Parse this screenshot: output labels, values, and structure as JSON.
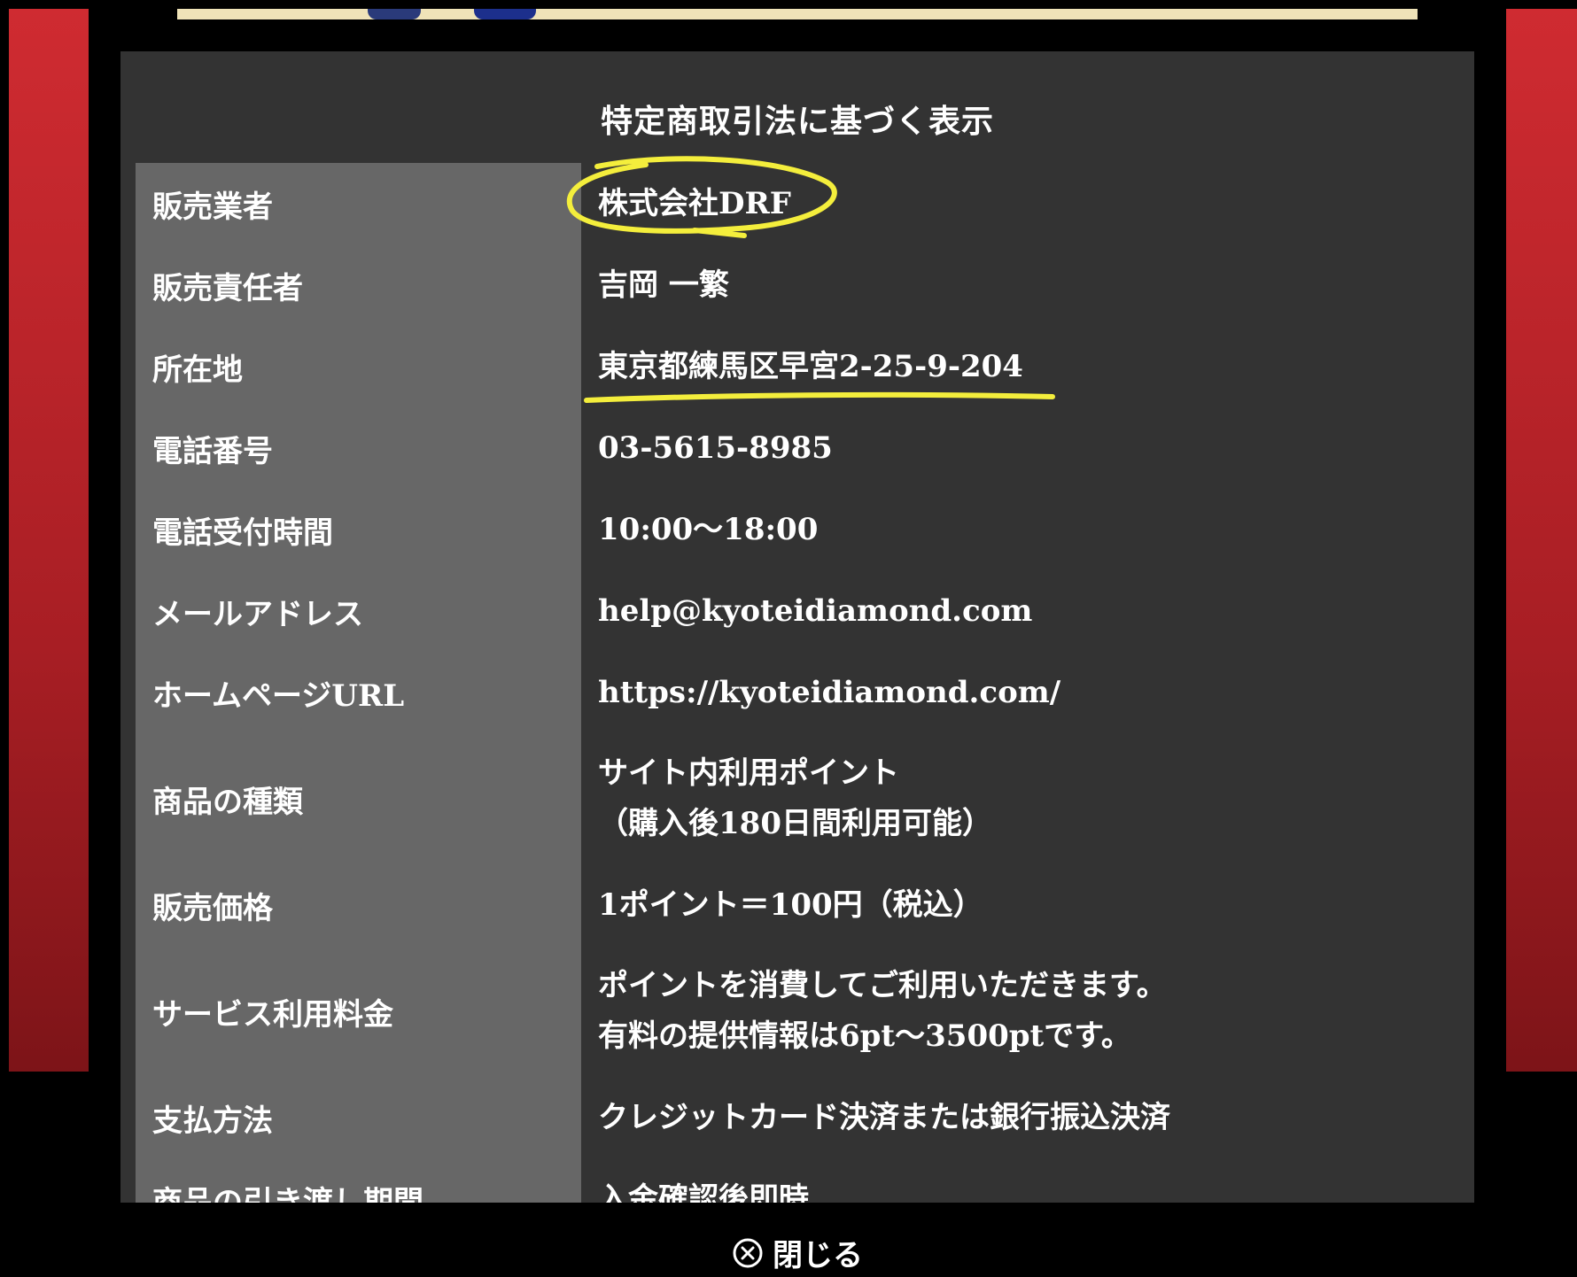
{
  "modal": {
    "title": "特定商取引法に基づく表示",
    "close_label": "閉じる"
  },
  "rows": [
    {
      "label": "販売業者",
      "value": [
        "株式会社DRF"
      ]
    },
    {
      "label": "販売責任者",
      "value": [
        "吉岡 一繁"
      ]
    },
    {
      "label": "所在地",
      "value": [
        "東京都練馬区早宮2-25-9-204"
      ]
    },
    {
      "label": "電話番号",
      "value": [
        "03-5615-8985"
      ]
    },
    {
      "label": "電話受付時間",
      "value": [
        "10:00〜18:00"
      ]
    },
    {
      "label": "メールアドレス",
      "value": [
        "help@kyoteidiamond.com"
      ]
    },
    {
      "label": "ホームページURL",
      "value": [
        "https://kyoteidiamond.com/"
      ]
    },
    {
      "label": "商品の種類",
      "value": [
        "サイト内利用ポイント",
        "（購入後180日間利用可能）"
      ]
    },
    {
      "label": "販売価格",
      "value": [
        "1ポイント＝100円（税込）"
      ]
    },
    {
      "label": "サービス利用料金",
      "value": [
        "ポイントを消費してご利用いただきます。",
        "有料の提供情報は6pt〜3500ptです。"
      ]
    },
    {
      "label": "支払方法",
      "value": [
        "クレジットカード決済または銀行振込決済"
      ]
    },
    {
      "label": "商品の引き渡し期間",
      "value": [
        "入金確認後即時"
      ]
    }
  ],
  "colors": {
    "background_red": "#cf2b31",
    "panel": "#333333",
    "label_cell": "#676767",
    "highlight_yellow": "#f4ee3c"
  }
}
